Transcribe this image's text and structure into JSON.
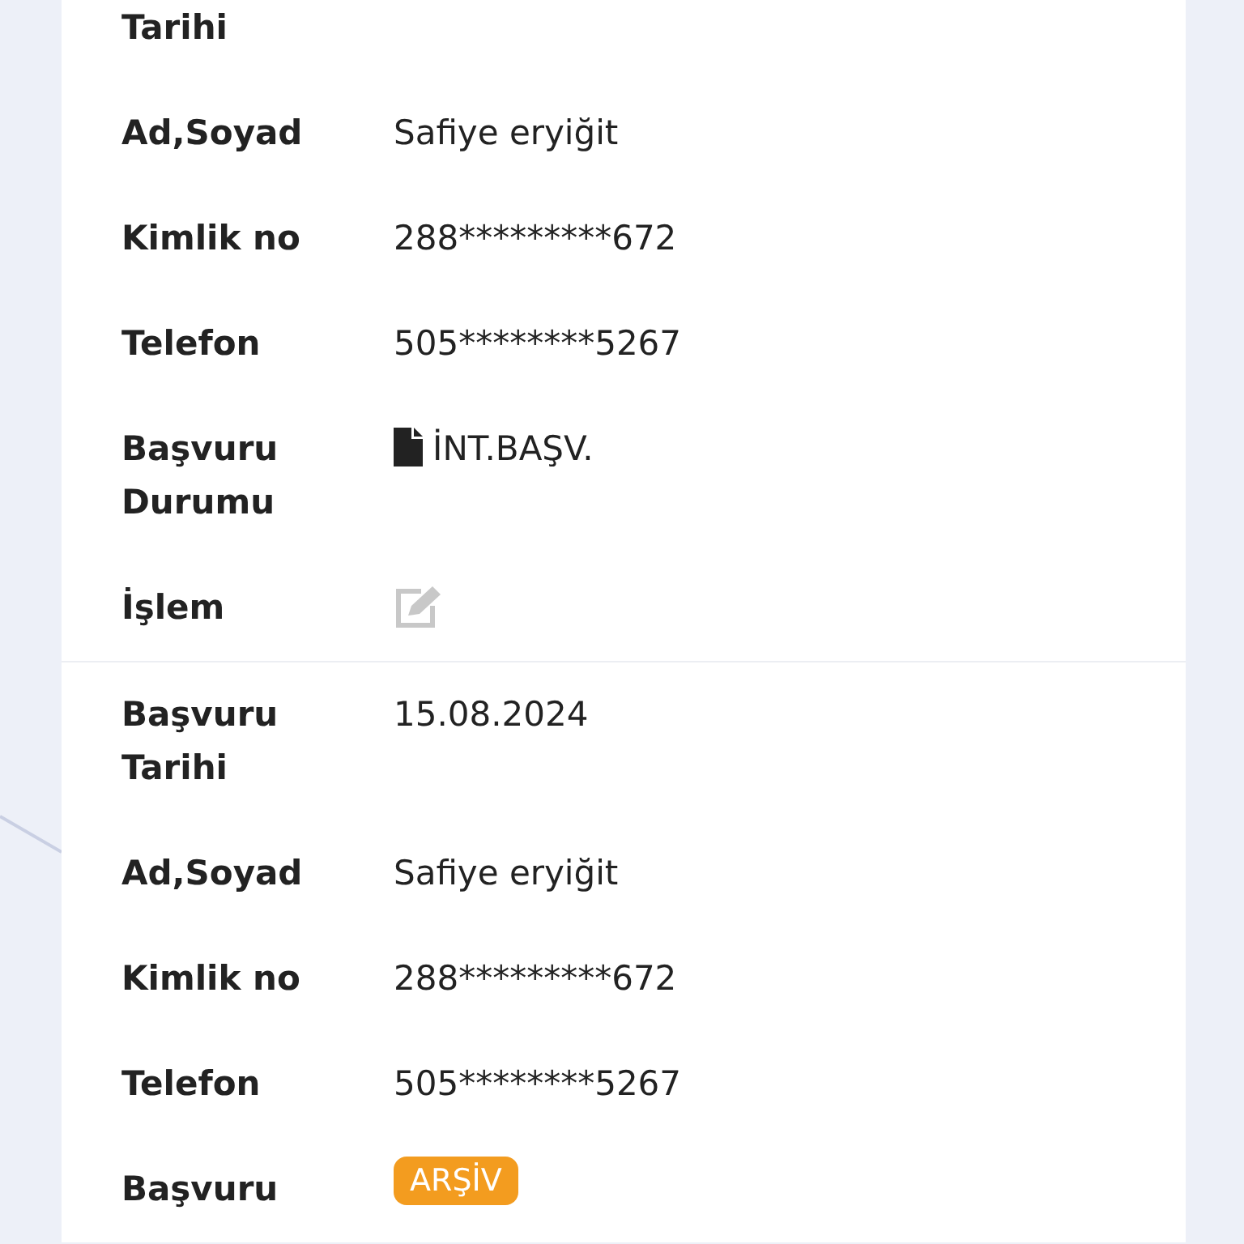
{
  "records": [
    {
      "fields": [
        {
          "kind": "text",
          "label": "Tarihi"
        },
        {
          "kind": "text",
          "label": "Ad,Soyad",
          "value": "Safiye eryiğit"
        },
        {
          "kind": "text",
          "label": "Kimlik no",
          "value": "288*********672"
        },
        {
          "kind": "text",
          "label": "Telefon",
          "value": "505********5267"
        },
        {
          "kind": "document",
          "label": "Başvuru Durumu",
          "value": "İNT.BAŞV."
        },
        {
          "kind": "edit",
          "label": "İşlem"
        }
      ]
    },
    {
      "fields": [
        {
          "kind": "text",
          "label": "Başvuru Tarihi",
          "value": "15.08.2024"
        },
        {
          "kind": "text",
          "label": "Ad,Soyad",
          "value": "Safiye eryiğit"
        },
        {
          "kind": "text",
          "label": "Kimlik no",
          "value": "288*********672"
        },
        {
          "kind": "text",
          "label": "Telefon",
          "value": "505********5267"
        },
        {
          "kind": "badge",
          "label": "Başvuru",
          "value": "ARŞİV",
          "color": "#f39c1f"
        }
      ]
    }
  ]
}
